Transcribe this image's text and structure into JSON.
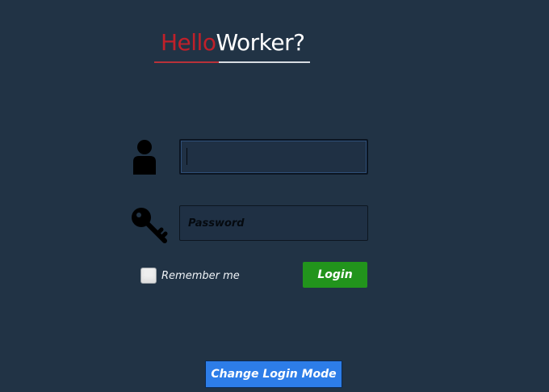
{
  "logo": {
    "part1": "Hello",
    "part2": "Worker?"
  },
  "form": {
    "username_value": "",
    "password_placeholder": "Password",
    "remember_label": "Remember me",
    "remember_checked": false,
    "login_label": "Login"
  },
  "footer": {
    "change_mode_label": "Change Login Mode"
  },
  "icons": {
    "user": "user-icon",
    "key": "key-icon"
  },
  "colors": {
    "background": "#213345",
    "logo_accent": "#c0202a",
    "login_button": "#22941c",
    "mode_button": "#2d7de8"
  }
}
